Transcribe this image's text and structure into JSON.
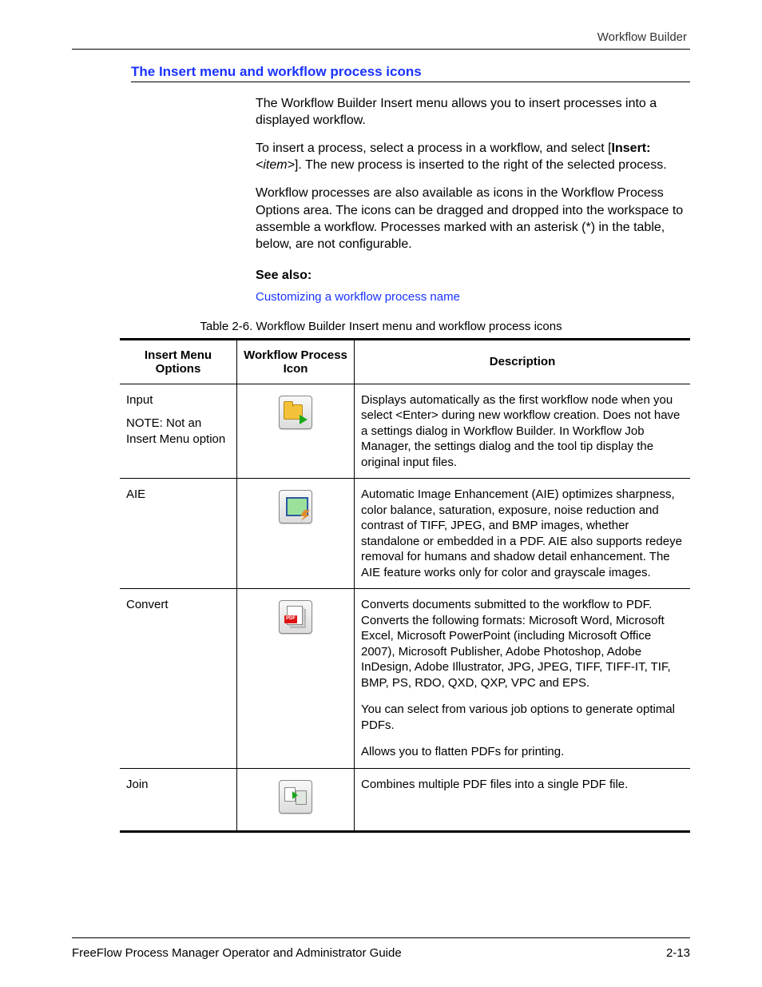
{
  "running_head": "Workflow Builder",
  "section_title": "The Insert menu and workflow process icons",
  "paragraphs": {
    "p1": "The Workflow Builder Insert menu allows you to insert processes into a displayed workflow.",
    "p2_pre": "To insert a process, select a process in a workflow, and select [",
    "p2_bold": "Insert:",
    "p2_ital": " <item>",
    "p2_post": "]. The new process is inserted to the right of the selected process.",
    "p3": "Workflow processes are also available as icons in the Workflow Process Options area. The icons can be dragged and dropped into the workspace to assemble a workflow. Processes marked with an asterisk (*) in the table, below, are not configurable."
  },
  "see_also_label": "See also:",
  "see_also_link": "Customizing a workflow process name",
  "table_caption": "Table 2-6.  Workflow Builder Insert menu and workflow process icons",
  "columns": {
    "col1": "Insert Menu Options",
    "col2": "Workflow Process Icon",
    "col3": "Description"
  },
  "rows": [
    {
      "option_main": "Input",
      "option_note": "NOTE: Not an Insert Menu option",
      "icon": "input",
      "desc": [
        "Displays automatically as the first workflow node when you select <Enter> during new workflow creation. Does not have a settings dialog in Workflow Builder. In Workflow Job Manager, the settings dialog and the tool tip display the original input files."
      ]
    },
    {
      "option_main": "AIE",
      "option_note": "",
      "icon": "aie",
      "desc": [
        "Automatic Image Enhancement (AIE) optimizes sharpness, color balance, saturation, exposure, noise reduction and contrast of TIFF, JPEG, and BMP images, whether standalone or embedded in a PDF. AIE also supports redeye removal for humans and shadow detail enhancement. The AIE feature works only for color and grayscale images."
      ]
    },
    {
      "option_main": "Convert",
      "option_note": "",
      "icon": "convert",
      "desc": [
        "Converts documents submitted to the workflow to PDF. Converts the following formats: Microsoft Word, Microsoft Excel, Microsoft PowerPoint (including Microsoft Office 2007), Microsoft Publisher, Adobe Photoshop, Adobe InDesign, Adobe Illustrator, JPG, JPEG, TIFF, TIFF-IT, TIF, BMP, PS, RDO, QXD, QXP, VPC and EPS.",
        "You can select from various job options to generate optimal PDFs.",
        "Allows you to flatten PDFs for printing."
      ]
    },
    {
      "option_main": "Join",
      "option_note": "",
      "icon": "join",
      "desc": [
        "Combines multiple PDF files into a single PDF file."
      ]
    }
  ],
  "footer_left": "FreeFlow Process Manager Operator and Administrator Guide",
  "footer_right": "2-13"
}
